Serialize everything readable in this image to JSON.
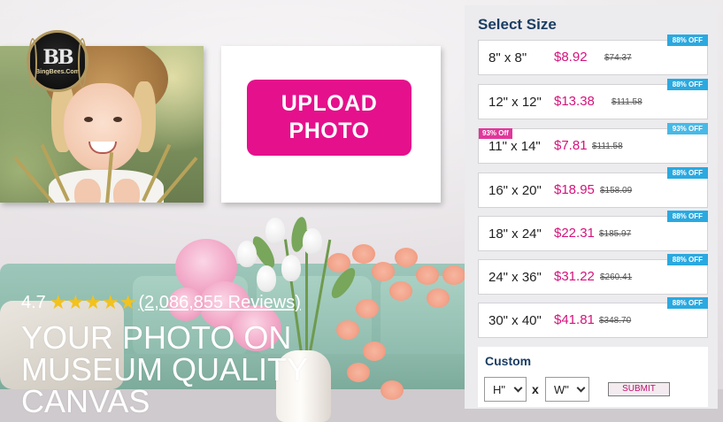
{
  "logo": {
    "text": "BingBees.Com",
    "mark": "BB"
  },
  "upload": {
    "label": "UPLOAD PHOTO"
  },
  "hero": {
    "rating": "4.7",
    "stars": [
      "★",
      "★",
      "★",
      "★",
      "★"
    ],
    "reviews": "(2,086,855 Reviews)",
    "title": "YOUR PHOTO ON MUSEUM QUALITY CANVAS"
  },
  "size_panel": {
    "title": "Select Size",
    "options": [
      {
        "size": "8\" x 8\"",
        "price": "$8.92",
        "old_price": "$74.37",
        "badge": "88% OFF"
      },
      {
        "size": "12\" x 12\"",
        "price": "$13.38",
        "old_price": "$111.58",
        "badge": "88% OFF"
      },
      {
        "size": "11\" x 14\"",
        "price": "$7.81",
        "old_price": "$111.58",
        "badge": "93% OFF",
        "tag": "93% Off"
      },
      {
        "size": "16\" x 20\"",
        "price": "$18.95",
        "old_price": "$158.09",
        "badge": "88% OFF"
      },
      {
        "size": "18\" x 24\"",
        "price": "$22.31",
        "old_price": "$185.97",
        "badge": "88% OFF"
      },
      {
        "size": "24\" x 36\"",
        "price": "$31.22",
        "old_price": "$260.41",
        "badge": "88% OFF"
      },
      {
        "size": "30\" x 40\"",
        "price": "$41.81",
        "old_price": "$348.70",
        "badge": "88% OFF"
      }
    ],
    "custom": {
      "title": "Custom",
      "height_value": "H\"",
      "width_value": "W\"",
      "separator": "x",
      "submit": "SUBMIT"
    }
  },
  "colors": {
    "brand_pink": "#e5108c",
    "price_pink": "#d4137c",
    "badge_blue": "#2aa9e0",
    "title_navy": "#1a3d64",
    "star_gold": "#f3c21b"
  }
}
